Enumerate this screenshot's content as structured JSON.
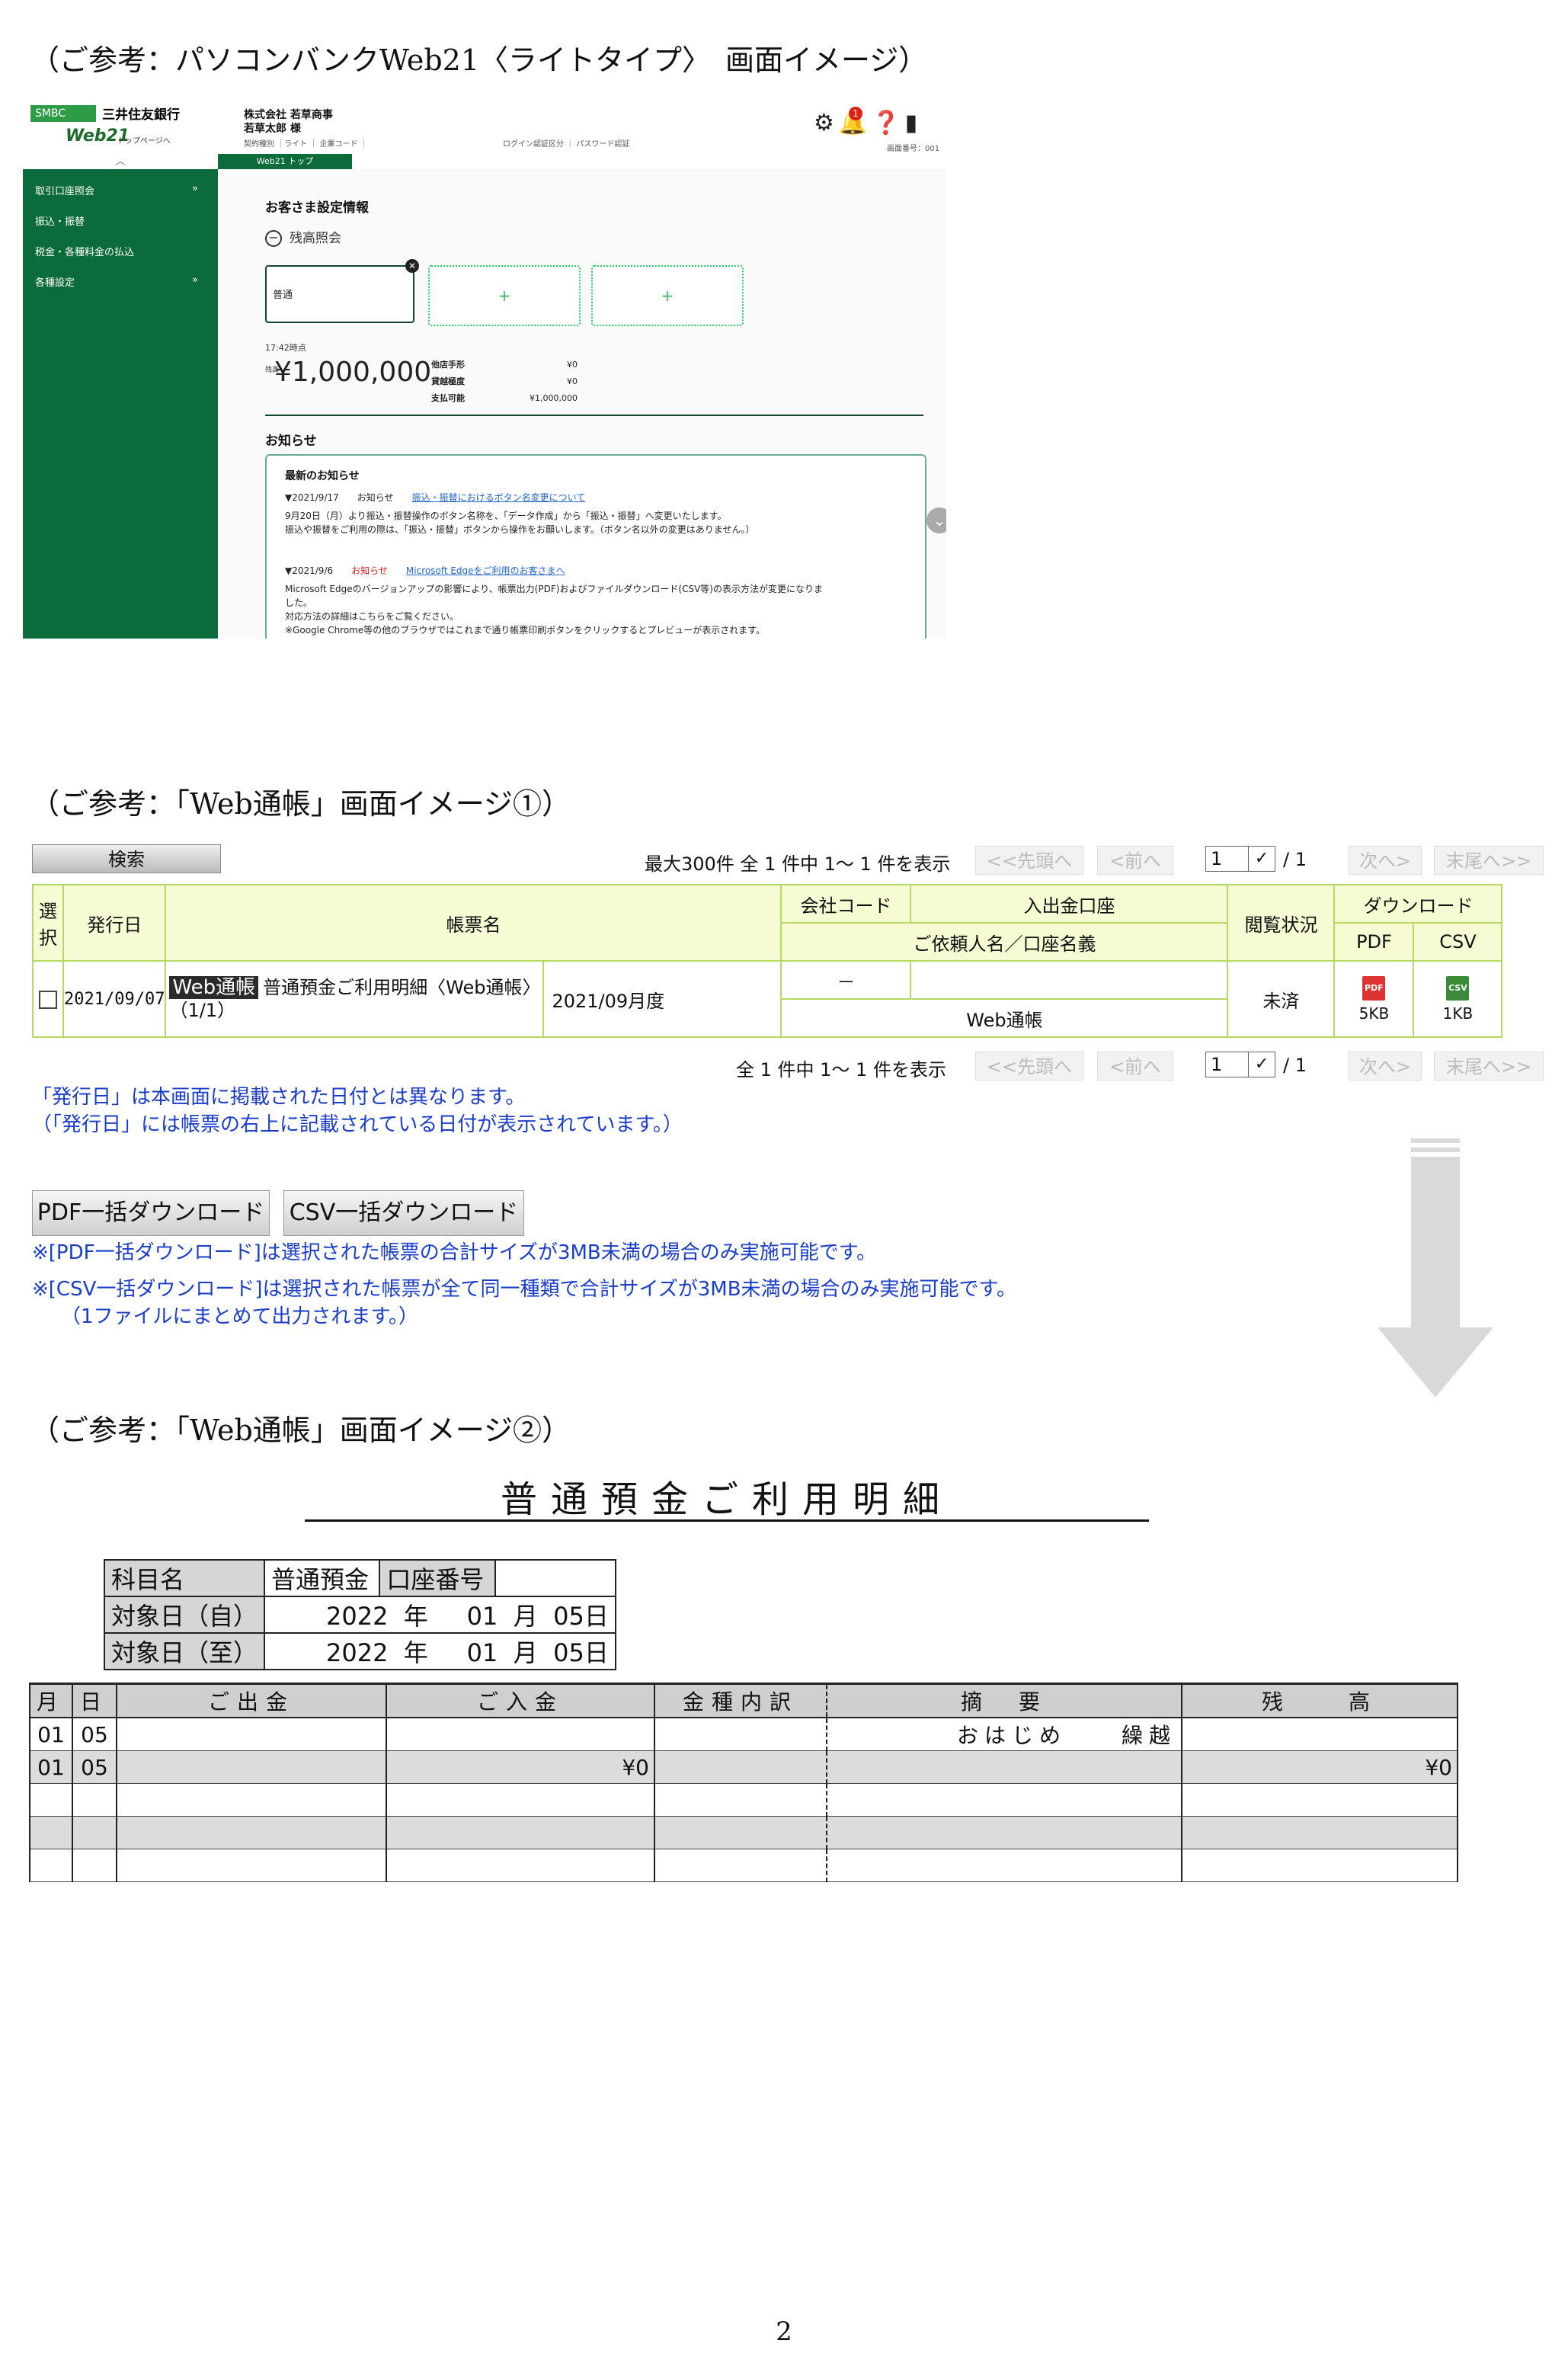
{
  "captions": {
    "c1": "（ご参考：パソコンバンクWeb21〈ライトタイプ〉　画面イメージ）",
    "c2": "（ご参考：「Web通帳」画面イメージ①）",
    "c3": "（ご参考：「Web通帳」画面イメージ②）"
  },
  "web21": {
    "logo_smbc": "SMBC",
    "bank_name": "三井住友銀行",
    "brand": "Web21",
    "top_link": "トップページへ",
    "company": "株式会社 若草商事",
    "user": "若草太郎 様",
    "meta_line": "契約種別 ｜ライト ｜ 企業コード ｜",
    "login_info": "ログイン認証区分 ｜ パスワード認証",
    "screen_no": "画面番号：001",
    "notification_count": "1",
    "breadcrumb": "Web21 トップ",
    "sidebar": [
      {
        "label": "取引口座照会",
        "arrow": "»"
      },
      {
        "label": "振込・振替",
        "arrow": ""
      },
      {
        "label": "税金・各種料金の払込",
        "arrow": ""
      },
      {
        "label": "各種設定",
        "arrow": "»"
      }
    ],
    "page_title": "お客さま設定情報",
    "balance_header": "残高照会",
    "card_label": "普通",
    "card_add": "+",
    "time": "17:42時点",
    "yen_label": "残高",
    "balance": "¥1,000,000",
    "kv": [
      {
        "k": "他店手形",
        "v": "¥0"
      },
      {
        "k": "貸越極度",
        "v": "¥0"
      },
      {
        "k": "支払可能",
        "v": "¥1,000,000"
      }
    ],
    "notice_title": "お知らせ",
    "latest": "最新のお知らせ",
    "n1_date": "▼2021/9/17",
    "n1_type": "お知らせ",
    "n1_link": "振込・振替におけるボタン名変更について",
    "n1_body1": "9月20日（月）より振込・振替操作のボタン名称を、「データ作成」から「振込・振替」へ変更いたします。",
    "n1_body2": "振込や振替をご利用の際は、「振込・振替」ボタンから操作をお願いします。（ボタン名以外の変更はありません。）",
    "n2_date": "▼2021/9/6",
    "n2_type": "お知らせ",
    "n2_link": "Microsoft Edgeをご利用のお客さまへ",
    "n2_body1": "Microsoft Edgeのバージョンアップの影響により、帳票出力(PDF)およびファイルダウンロード(CSV等)の表示方法が変更になりま",
    "n2_body2": "した。",
    "n2_body3": "対応方法の詳細はこちらをご覧ください。",
    "n2_body4": "※Google Chrome等の他のブラウザではこれまで通り帳票印刷ボタンをクリックするとプレビューが表示されます。"
  },
  "tsucho": {
    "search_button": "検索",
    "paging_top": "最大300件 全 1 件中  1～ 1 件を表示",
    "paging_bottom": "全 1 件中  1～ 1 件を表示",
    "btn_first": "<<先頭へ",
    "btn_prev": "<前へ",
    "btn_next": "次へ>",
    "btn_last": "末尾へ>>",
    "page_select": "1",
    "page_total": "/ 1",
    "headers": {
      "select": "選択",
      "issue_date": "発行日",
      "doc_name": "帳票名",
      "company_code": "会社コード",
      "account": "入出金口座",
      "requester": "ご依頼人名／口座名義",
      "view_status": "閲覧状況",
      "download": "ダウンロード",
      "pdf": "PDF",
      "csv": "CSV"
    },
    "row": {
      "issue_date": "2021/09/07",
      "badge": "Web通帳",
      "doc_name": "普通預金ご利用明細〈Web通帳〉",
      "doc_sub": "（1/1）",
      "period": "2021/09月度",
      "company_code": "－",
      "account_name": "Web通帳",
      "status": "未済",
      "pdf_size": "5KB",
      "csv_size": "1KB",
      "pdf_icon": "PDF",
      "csv_icon": "CSV"
    },
    "note_date1": "「発行日」は本画面に掲載された日付とは異なります。",
    "note_date2": "（「発行日」には帳票の右上に記載されている日付が表示されています。）",
    "btn_pdf_bulk": "PDF一括ダウンロード",
    "btn_csv_bulk": "CSV一括ダウンロード",
    "note_pdf": "※[PDF一括ダウンロード]は選択された帳票の合計サイズが3MB未満の場合のみ実施可能です。",
    "note_csv1": "※[CSV一括ダウンロード]は選択された帳票が全て同一種類で合計サイズが3MB未満の場合のみ実施可能です。",
    "note_csv2": "（1ファイルにまとめて出力されます。）"
  },
  "statement": {
    "title": "普通預金ご利用明細",
    "subject_label": "科目名",
    "subject_value": "普通預金",
    "account_no_label": "口座番号",
    "account_no_value": "",
    "from_label": "対象日（自）",
    "to_label": "対象日（至）",
    "from_year": "2022",
    "from_month": "01",
    "from_day": "05",
    "to_year": "2022",
    "to_month": "01",
    "to_day": "05",
    "u_year": "年",
    "u_month": "月",
    "u_day": "日",
    "headers": [
      "月",
      "日",
      "ご出金",
      "ご入金",
      "金種内訳",
      "摘　要",
      "残　　高"
    ],
    "rows": [
      {
        "m": "01",
        "d": "05",
        "out": "",
        "in": "",
        "kind": "",
        "desc": "おはじめ　　繰越",
        "bal": ""
      },
      {
        "m": "01",
        "d": "05",
        "out": "",
        "in": "¥0",
        "kind": "",
        "desc": "",
        "bal": "¥0"
      },
      {
        "m": "",
        "d": "",
        "out": "",
        "in": "",
        "kind": "",
        "desc": "",
        "bal": ""
      },
      {
        "m": "",
        "d": "",
        "out": "",
        "in": "",
        "kind": "",
        "desc": "",
        "bal": ""
      },
      {
        "m": "",
        "d": "",
        "out": "",
        "in": "",
        "kind": "",
        "desc": "",
        "bal": ""
      }
    ]
  },
  "page_number": "2"
}
